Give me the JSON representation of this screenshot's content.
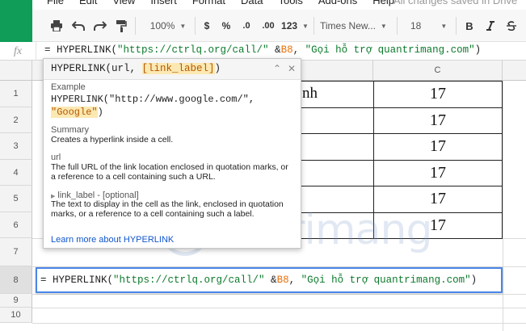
{
  "menubar": {
    "items": [
      "File",
      "Edit",
      "View",
      "Insert",
      "Format",
      "Data",
      "Tools",
      "Add-ons",
      "Help"
    ],
    "saved": "All changes saved in Drive"
  },
  "toolbar": {
    "zoom": "100%",
    "currency": "$",
    "percent": "%",
    "dec_decrease": ".0",
    "dec_increase": ".00",
    "more_formats": "123",
    "font": "Times New...",
    "font_size": "18",
    "bold": "B"
  },
  "formula_bar": {
    "fx": "fx",
    "prefix": "= HYPERLINK(",
    "url": "\"https://ctrlq.org/call/\"",
    "amp": " &",
    "ref": "B8",
    "sep": ", ",
    "label": "\"Gọi hỗ trợ quantrimang.com\"",
    "close": ")"
  },
  "grid": {
    "col_c": "C",
    "rows": [
      "1",
      "2",
      "3",
      "4",
      "5",
      "6",
      "7",
      "8",
      "9",
      "10"
    ],
    "b1_partial": "nh",
    "c_values": [
      "17",
      "17",
      "17",
      "17",
      "17",
      "17"
    ]
  },
  "popup": {
    "sig_name": "HYPERLINK(url, ",
    "sig_param": "[link_label]",
    "sig_close": ")",
    "example_label": "Example",
    "example_line1": "HYPERLINK(\"http://www.google.com/\",",
    "example_line2": "\"Google\"",
    "example_line2_close": ")",
    "summary_label": "Summary",
    "summary_text": "Creates a hyperlink inside a cell.",
    "url_label": "url",
    "url_text": "The full URL of the link location enclosed in quotation marks, or a reference to a cell containing such a URL.",
    "link_label_label": "link_label - [optional]",
    "link_label_text": "The text to display in the cell as the link, enclosed in quotation marks, or a reference to a cell containing such a label.",
    "learn_more": "Learn more about HYPERLINK"
  },
  "editor": {
    "prefix": "= HYPERLINK(",
    "url": "\"https://ctrlq.org/call/\"",
    "amp": " &",
    "ref": "B8",
    "sep": ", ",
    "label": "\"Gọi hỗ trợ quantrimang.com\"",
    "close": ")"
  },
  "watermark": "uantrimang",
  "colors": {
    "accent": "#0f9d58",
    "active_border": "#4a86e8",
    "string": "#0c7a2c",
    "reference": "#e8710a",
    "link": "#1155cc"
  }
}
